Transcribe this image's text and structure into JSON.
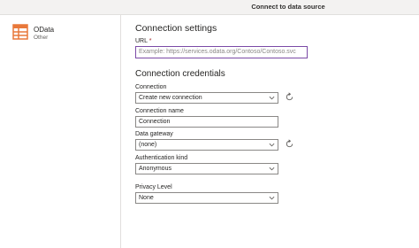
{
  "window": {
    "title": "Connect to data source"
  },
  "datasource": {
    "name": "OData",
    "category": "Other",
    "icon": "table-grid-icon",
    "icon_color": "#e8783a"
  },
  "settings": {
    "heading": "Connection settings",
    "url_label": "URL",
    "url_required_mark": "*",
    "url_placeholder": "Example: https://services.odata.org/Contoso/Contoso.svc"
  },
  "credentials": {
    "heading": "Connection credentials",
    "connection_label": "Connection",
    "connection_value": "Create new connection",
    "connection_name_label": "Connection name",
    "connection_name_value": "Connection",
    "gateway_label": "Data gateway",
    "gateway_value": "(none)",
    "auth_label": "Authentication kind",
    "auth_value": "Anonymous",
    "privacy_label": "Privacy Level",
    "privacy_value": "None"
  },
  "colors": {
    "focus_border": "#7b4aa6",
    "required": "#a4262c"
  }
}
